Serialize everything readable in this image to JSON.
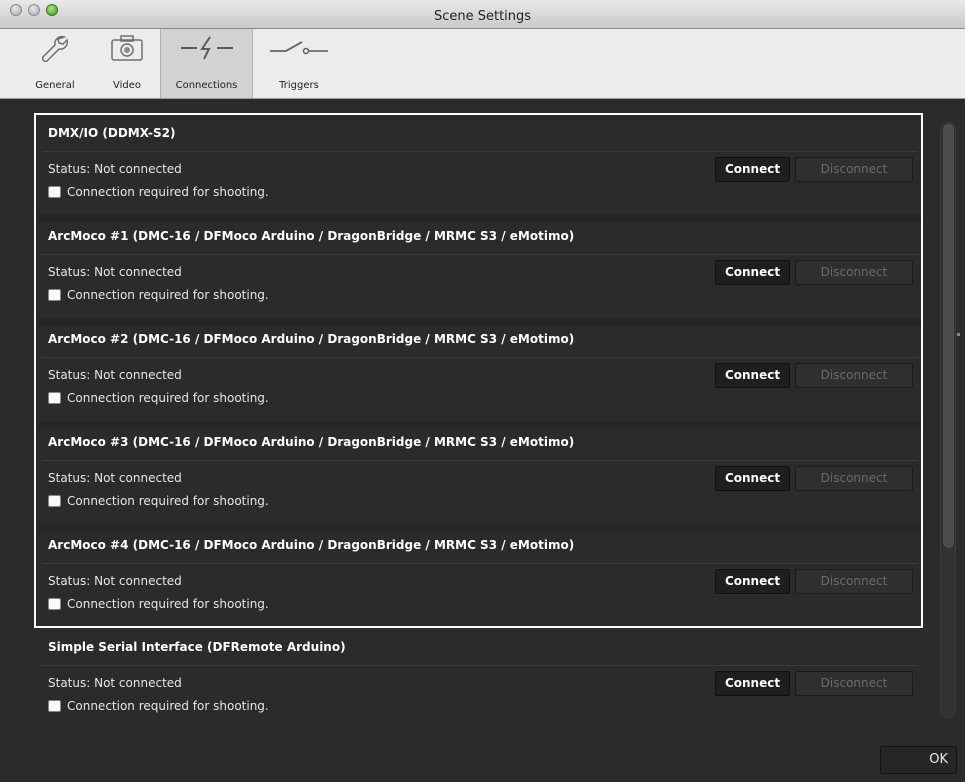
{
  "window": {
    "title": "Scene Settings"
  },
  "toolbar": {
    "tabs": [
      {
        "label": "General",
        "icon": "wrench-icon"
      },
      {
        "label": "Video",
        "icon": "camera-icon"
      },
      {
        "label": "Connections",
        "icon": "connection-icon",
        "selected": true
      },
      {
        "label": "Triggers",
        "icon": "switch-icon"
      }
    ]
  },
  "connections": [
    {
      "title": "DMX/IO (DDMX-S2)",
      "status": "Status: Not connected",
      "required_label": "Connection required for shooting.",
      "connect_label": "Connect",
      "disconnect_label": "Disconnect"
    },
    {
      "title": "ArcMoco #1 (DMC-16 / DFMoco Arduino / DragonBridge / MRMC S3 / eMotimo)",
      "status": "Status: Not connected",
      "required_label": "Connection required for shooting.",
      "connect_label": "Connect",
      "disconnect_label": "Disconnect"
    },
    {
      "title": "ArcMoco #2 (DMC-16 / DFMoco Arduino / DragonBridge / MRMC S3 / eMotimo)",
      "status": "Status: Not connected",
      "required_label": "Connection required for shooting.",
      "connect_label": "Connect",
      "disconnect_label": "Disconnect"
    },
    {
      "title": "ArcMoco #3 (DMC-16 / DFMoco Arduino / DragonBridge / MRMC S3 / eMotimo)",
      "status": "Status: Not connected",
      "required_label": "Connection required for shooting.",
      "connect_label": "Connect",
      "disconnect_label": "Disconnect"
    },
    {
      "title": "ArcMoco #4 (DMC-16 / DFMoco Arduino / DragonBridge / MRMC S3 / eMotimo)",
      "status": "Status: Not connected",
      "required_label": "Connection required for shooting.",
      "connect_label": "Connect",
      "disconnect_label": "Disconnect"
    },
    {
      "title": "Simple Serial Interface (DFRemote Arduino)",
      "status": "Status: Not connected",
      "required_label": "Connection required for shooting.",
      "connect_label": "Connect",
      "disconnect_label": "Disconnect"
    }
  ],
  "footer": {
    "ok_label": "OK"
  },
  "colors": {
    "panel_bg": "#2b2b2b",
    "highlight": "#ffffff",
    "disabled_text": "#6a6a6a"
  }
}
